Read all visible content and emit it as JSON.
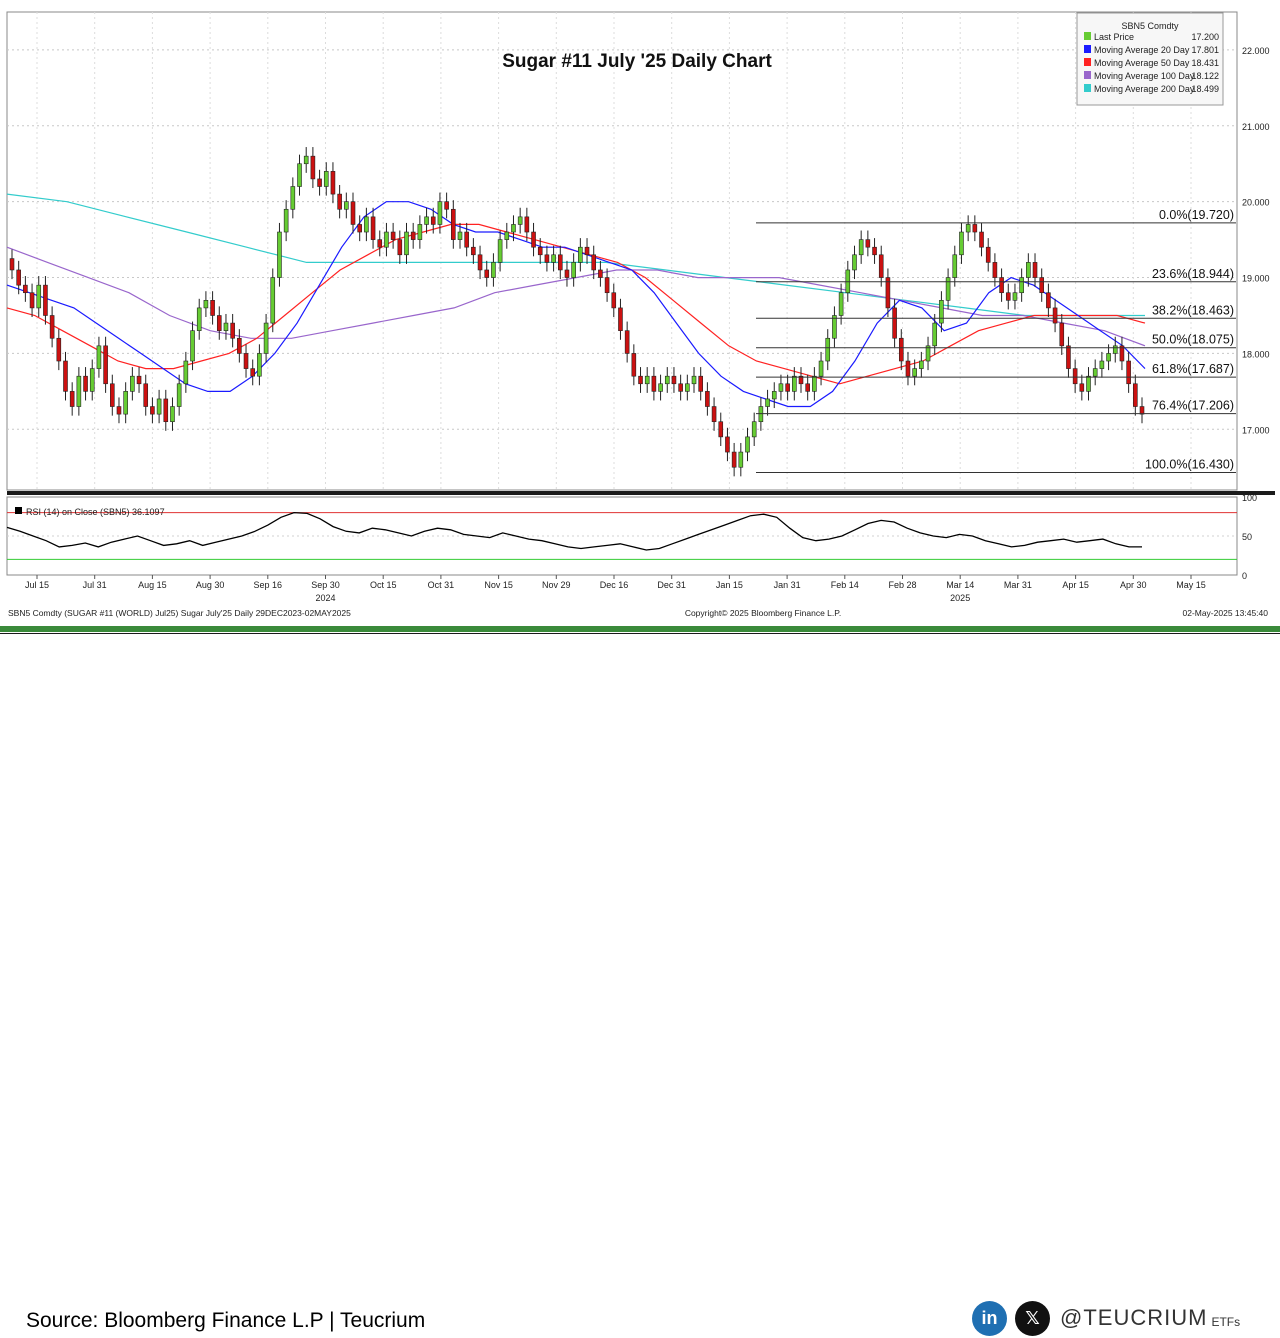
{
  "chart_data": {
    "type": "candlestick",
    "title": "Sugar #11 July '25 Daily Chart",
    "price_axis": {
      "ylim": [
        16.2,
        22.5
      ],
      "ticks": [
        "22.000",
        "21.000",
        "20.000",
        "19.000",
        "18.000",
        "17.000"
      ]
    },
    "x_ticks": [
      "Jul 15",
      "Jul 31",
      "Aug 15",
      "Aug 30",
      "Sep 16",
      "Sep 30",
      "Oct 15",
      "Oct 31",
      "Nov 15",
      "Nov 29",
      "Dec 16",
      "Dec 31",
      "Jan 15",
      "Jan 31",
      "Feb 14",
      "Feb 28",
      "Mar 14",
      "Mar 31",
      "Apr 15",
      "Apr 30",
      "May 15"
    ],
    "year_labels": [
      {
        "label": "2024",
        "at": "Sep 30"
      },
      {
        "label": "2025",
        "at": "Mar 14"
      }
    ],
    "legend": {
      "header": "SBN5 Comdty",
      "items": [
        {
          "name": "Last Price",
          "value": "17.200",
          "color": "#66cc33"
        },
        {
          "name": "Moving Average 20 Day",
          "value": "17.801",
          "color": "#1a1aff"
        },
        {
          "name": "Moving Average 50 Day",
          "value": "18.431",
          "color": "#ff2222"
        },
        {
          "name": "Moving Average 100 Day",
          "value": "18.122",
          "color": "#9966cc"
        },
        {
          "name": "Moving Average 200 Day",
          "value": "18.499",
          "color": "#33cccc"
        }
      ],
      "placement": "top-right"
    },
    "fibonacci": [
      {
        "label": "0.0%(19.720)",
        "value": 19.72
      },
      {
        "label": "23.6%(18.944)",
        "value": 18.944
      },
      {
        "label": "38.2%(18.463)",
        "value": 18.463
      },
      {
        "label": "50.0%(18.075)",
        "value": 18.075
      },
      {
        "label": "61.8%(17.687)",
        "value": 17.687
      },
      {
        "label": "76.4%(17.206)",
        "value": 17.206
      },
      {
        "label": "100.0%(16.430)",
        "value": 16.43
      }
    ],
    "closes": [
      19.1,
      18.9,
      18.8,
      18.6,
      18.9,
      18.5,
      18.2,
      17.9,
      17.5,
      17.3,
      17.7,
      17.5,
      17.8,
      18.1,
      17.6,
      17.3,
      17.2,
      17.5,
      17.7,
      17.6,
      17.3,
      17.2,
      17.4,
      17.1,
      17.3,
      17.6,
      17.9,
      18.3,
      18.6,
      18.7,
      18.5,
      18.3,
      18.4,
      18.2,
      18.0,
      17.8,
      17.7,
      18.0,
      18.4,
      19.0,
      19.6,
      19.9,
      20.2,
      20.5,
      20.6,
      20.3,
      20.2,
      20.4,
      20.1,
      19.9,
      20.0,
      19.7,
      19.6,
      19.8,
      19.5,
      19.4,
      19.6,
      19.5,
      19.3,
      19.6,
      19.5,
      19.7,
      19.8,
      19.7,
      20.0,
      19.9,
      19.5,
      19.6,
      19.4,
      19.3,
      19.1,
      19.0,
      19.2,
      19.5,
      19.6,
      19.7,
      19.8,
      19.6,
      19.4,
      19.3,
      19.2,
      19.3,
      19.1,
      19.0,
      19.2,
      19.4,
      19.3,
      19.1,
      19.0,
      18.8,
      18.6,
      18.3,
      18.0,
      17.7,
      17.6,
      17.7,
      17.5,
      17.6,
      17.7,
      17.6,
      17.5,
      17.6,
      17.7,
      17.5,
      17.3,
      17.1,
      16.9,
      16.7,
      16.5,
      16.7,
      16.9,
      17.1,
      17.3,
      17.4,
      17.5,
      17.6,
      17.5,
      17.7,
      17.6,
      17.5,
      17.7,
      17.9,
      18.2,
      18.5,
      18.8,
      19.1,
      19.3,
      19.5,
      19.4,
      19.3,
      19.0,
      18.6,
      18.2,
      17.9,
      17.7,
      17.8,
      17.9,
      18.1,
      18.4,
      18.7,
      19.0,
      19.3,
      19.6,
      19.7,
      19.6,
      19.4,
      19.2,
      19.0,
      18.8,
      18.7,
      18.8,
      19.0,
      19.2,
      19.0,
      18.8,
      18.6,
      18.4,
      18.1,
      17.8,
      17.6,
      17.5,
      17.7,
      17.8,
      17.9,
      18.0,
      18.1,
      17.9,
      17.6,
      17.3,
      17.2
    ],
    "moving_averages": {
      "ma20": [
        18.9,
        18.8,
        18.7,
        18.6,
        18.4,
        18.2,
        18.0,
        17.8,
        17.6,
        17.5,
        17.5,
        17.7,
        18.0,
        18.4,
        18.9,
        19.4,
        19.8,
        20.0,
        20.0,
        19.9,
        19.7,
        19.6,
        19.6,
        19.5,
        19.4,
        19.4,
        19.3,
        19.2,
        19.1,
        18.8,
        18.4,
        18.0,
        17.7,
        17.5,
        17.4,
        17.3,
        17.3,
        17.5,
        17.9,
        18.4,
        18.7,
        18.6,
        18.3,
        18.4,
        18.8,
        19.0,
        18.9,
        18.7,
        18.5,
        18.3,
        18.1,
        17.8
      ],
      "ma50": [
        18.6,
        18.5,
        18.3,
        18.1,
        17.9,
        17.8,
        17.8,
        17.9,
        18.0,
        18.2,
        18.5,
        18.8,
        19.1,
        19.3,
        19.5,
        19.6,
        19.7,
        19.7,
        19.6,
        19.5,
        19.4,
        19.3,
        19.2,
        19.0,
        18.7,
        18.4,
        18.1,
        17.9,
        17.8,
        17.7,
        17.6,
        17.7,
        17.8,
        17.9,
        18.1,
        18.3,
        18.4,
        18.5,
        18.5,
        18.5,
        18.5,
        18.4
      ],
      "ma100": [
        19.4,
        19.2,
        19.0,
        18.8,
        18.5,
        18.3,
        18.2,
        18.2,
        18.3,
        18.4,
        18.5,
        18.6,
        18.8,
        18.9,
        19.0,
        19.1,
        19.1,
        19.0,
        19.0,
        19.0,
        18.9,
        18.8,
        18.7,
        18.6,
        18.5,
        18.5,
        18.4,
        18.3,
        18.1
      ],
      "ma200": [
        20.1,
        20.0,
        19.8,
        19.6,
        19.4,
        19.2,
        19.2,
        19.2,
        19.2,
        19.2,
        19.2,
        19.1,
        19.0,
        18.9,
        18.8,
        18.7,
        18.6,
        18.5,
        18.5,
        18.5
      ]
    },
    "rsi": {
      "label": "RSI (14)   on Close (SBN5) 36.1097",
      "ylim": [
        0,
        100
      ],
      "ticks": [
        "100",
        "50",
        "0"
      ],
      "overbought": 80,
      "oversold": 20,
      "values": [
        61,
        56,
        50,
        44,
        36,
        38,
        41,
        36,
        42,
        46,
        50,
        44,
        38,
        40,
        44,
        38,
        42,
        46,
        50,
        56,
        64,
        74,
        80,
        79,
        72,
        62,
        56,
        54,
        60,
        58,
        54,
        50,
        56,
        60,
        58,
        52,
        50,
        48,
        54,
        50,
        46,
        44,
        40,
        36,
        34,
        36,
        38,
        40,
        36,
        32,
        34,
        40,
        46,
        52,
        58,
        64,
        70,
        76,
        78,
        74,
        60,
        48,
        44,
        46,
        50,
        58,
        66,
        70,
        68,
        60,
        54,
        50,
        48,
        52,
        50,
        44,
        40,
        36,
        38,
        42,
        44,
        46,
        42,
        44,
        46,
        40,
        36,
        36
      ]
    },
    "bottom_info": {
      "left": "SBN5 Comdty (SUGAR #11 (WORLD) Jul25) Sugar July'25  Daily 29DEC2023-02MAY2025",
      "center": "Copyright© 2025 Bloomberg Finance L.P.",
      "right": "02-May-2025 13:45:40"
    },
    "colors": {
      "up": "#66cc33",
      "down": "#cc1111",
      "rsi_line": "#000000",
      "overbought_line": "#e03333",
      "oversold_line": "#33cc33",
      "separator": "#3a8a3a"
    }
  },
  "footer": {
    "source": "Source: Bloomberg Finance L.P | Teucrium",
    "linkedin_glyph": "in",
    "x_glyph": "𝕏",
    "handle": "@TEUCRIUM",
    "etfs": "ETFs",
    "colors": {
      "linkedin": "#1f6fb2",
      "x": "#111111"
    }
  }
}
